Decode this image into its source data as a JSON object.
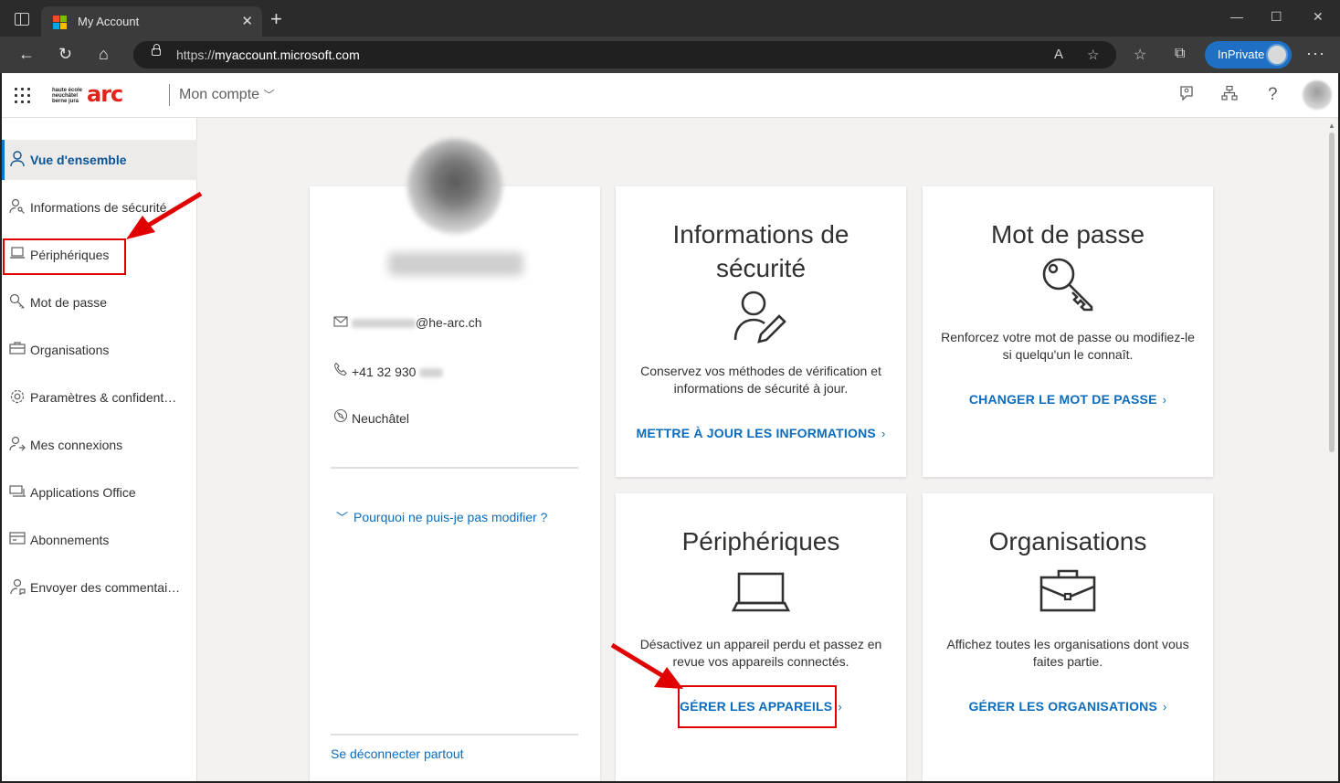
{
  "browser": {
    "tab_title": "My Account",
    "url_prefix": "https://",
    "url_host": "myaccount.microsoft.com",
    "inprivate_label": "InPrivate"
  },
  "header": {
    "brand_small": "haute école neuchâtel berne jura",
    "brand_big": "arc",
    "app_name": "Mon compte"
  },
  "sidebar": {
    "items": [
      {
        "label": "Vue d'ensemble",
        "icon": "person-icon",
        "active": true
      },
      {
        "label": "Informations de sécurité",
        "icon": "person-key-icon"
      },
      {
        "label": "Périphériques",
        "icon": "laptop-icon"
      },
      {
        "label": "Mot de passe",
        "icon": "key-icon"
      },
      {
        "label": "Organisations",
        "icon": "briefcase-icon"
      },
      {
        "label": "Paramètres & confident…",
        "icon": "gear-icon"
      },
      {
        "label": "Mes connexions",
        "icon": "person-arrows-icon"
      },
      {
        "label": "Applications Office",
        "icon": "office-apps-icon"
      },
      {
        "label": "Abonnements",
        "icon": "card-icon"
      },
      {
        "label": "Envoyer des commentai…",
        "icon": "feedback-icon"
      }
    ]
  },
  "profile": {
    "email_suffix": "@he-arc.ch",
    "phone_prefix": "+41 32 930",
    "location": "Neuchâtel",
    "why_link": "Pourquoi ne puis-je pas modifier ?",
    "signout_link": "Se déconnecter partout"
  },
  "tiles": {
    "security": {
      "title_line1": "Informations de",
      "title_line2": "sécurité",
      "desc": "Conservez vos méthodes de vérification et informations de sécurité à jour.",
      "link": "METTRE À JOUR LES INFORMATIONS"
    },
    "password": {
      "title": "Mot de passe",
      "desc": "Renforcez votre mot de passe ou modifiez-le si quelqu'un le connaît.",
      "link": "CHANGER LE MOT DE PASSE"
    },
    "devices": {
      "title": "Périphériques",
      "desc": "Désactivez un appareil perdu et passez en revue vos appareils connectés.",
      "link": "GÉRER LES APPAREILS"
    },
    "organisations": {
      "title": "Organisations",
      "desc": "Affichez toutes les organisations dont vous faites partie.",
      "link": "GÉRER LES ORGANISATIONS"
    }
  },
  "colors": {
    "accent": "#0078d4",
    "link": "#0b6cbd",
    "annotation": "#e00000",
    "brand": "#e2231a"
  }
}
